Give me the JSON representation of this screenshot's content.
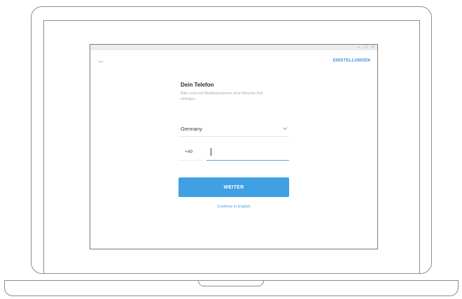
{
  "window": {
    "controls": {
      "minimize": "–",
      "maximize": "□",
      "close": "×"
    }
  },
  "header": {
    "back_icon": "arrow-left-icon",
    "back_glyph": "←",
    "settings_label": "EINSTELLUNGEN"
  },
  "login": {
    "title": "Dein Telefon",
    "description": "Bitte Land und Mobilfunknummer ohne führende Null eintragen.",
    "country": "Germany",
    "country_code": "+49",
    "phone_value": "",
    "continue_label": "WEITER",
    "english_link": "Continue in English"
  },
  "colors": {
    "accent": "#3fa0e3",
    "link": "#3a8dde"
  }
}
